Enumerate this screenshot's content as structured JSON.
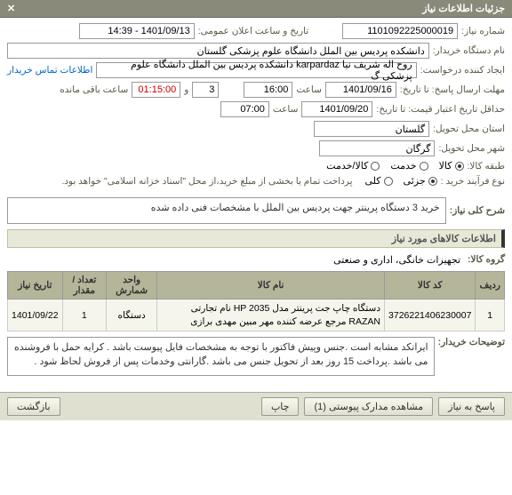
{
  "header": {
    "title": "جزئیات اطلاعات نیاز"
  },
  "form": {
    "need_no_label": "شماره نیاز:",
    "need_no": "1101092225000019",
    "date_label": "تاریخ و ساعت اعلان عمومی:",
    "date_val": "1401/09/13 - 14:39",
    "buyer_label": "نام دستگاه خریدار:",
    "buyer_val": "دانشکده پردیس بین الملل دانشگاه علوم پزشکی گلستان",
    "creator_label": "ایجاد کننده درخواست:",
    "creator_val": "روح اله شریف نیا karpardaz دانشکده پردیس بین الملل دانشگاه علوم پزشکی گ",
    "contact_link": "اطلاعات تماس خریدار",
    "deadline_resp_label": "مهلت ارسال پاسخ: تا تاریخ:",
    "deadline_resp_date": "1401/09/16",
    "hour_label": "ساعت",
    "deadline_resp_time": "16:00",
    "remain_label": "ساعت باقی مانده",
    "remain_val": "01:15:00",
    "remain_and": "و",
    "remain_days": "3",
    "price_deadline_label": "حداقل تاریخ اعتبار قیمت: تا تاریخ:",
    "price_deadline_date": "1401/09/20",
    "price_deadline_time": "07:00",
    "province_label": "استان محل تحویل:",
    "province_val": "گلستان",
    "city_label": "شهر محل تحویل:",
    "city_val": "گرگان",
    "category_label": "طبقه کالا:",
    "cat_goods": "کالا",
    "cat_service": "خدمت",
    "cat_goods_service": "کالا/خدمت",
    "process_label": "نوع فرآیند خرید :",
    "proc_partial": "جزئی",
    "proc_full": "کلی",
    "proc_note": "پرداخت تمام یا بخشی از مبلغ خرید،از محل \"اسناد خزانه اسلامی\" خواهد بود.",
    "need_desc_label": "شرح کلی نیاز:",
    "need_desc_val": "خرید 3 دستگاه پرینتر جهت پردیس بین الملل با مشخصات فنی داده شده",
    "goods_section": "اطلاعات کالاهای مورد نیاز",
    "group_label": "گروه کالا:",
    "group_val": "تجهیزات خانگی، اداری و صنعتی",
    "table": {
      "h_row": "ردیف",
      "h_code": "کد کالا",
      "h_name": "نام کالا",
      "h_unit": "واحد شمارش",
      "h_qty": "تعداد / مقدار",
      "h_date": "تاریخ نیاز",
      "rows": [
        {
          "idx": "1",
          "code": "3726221406230007",
          "name": "دستگاه چاپ جت پرینتر مدل HP 2035 نام تجارتی RAZAN مرجع عرضه کننده مهر مبین مهدی برازی",
          "unit": "دستگاه",
          "qty": "1",
          "date": "1401/09/22"
        }
      ]
    },
    "notes_label": "توضیحات خریدار:",
    "notes_val": "ایرانکد مشابه است .جنس وپیش فاکتور با توجه به مشخصات فایل پیوست باشد . کرایه حمل با فروشنده می باشد .پرداخت 15 روز بعد از تحویل جنس می باشد .گارانتی وخدمات پس از فروش لحاظ شود ."
  },
  "footer": {
    "reply": "پاسخ به نیاز",
    "attach": "مشاهده مدارک پیوستی  (1)",
    "print": "چاپ",
    "back": "بازگشت"
  }
}
